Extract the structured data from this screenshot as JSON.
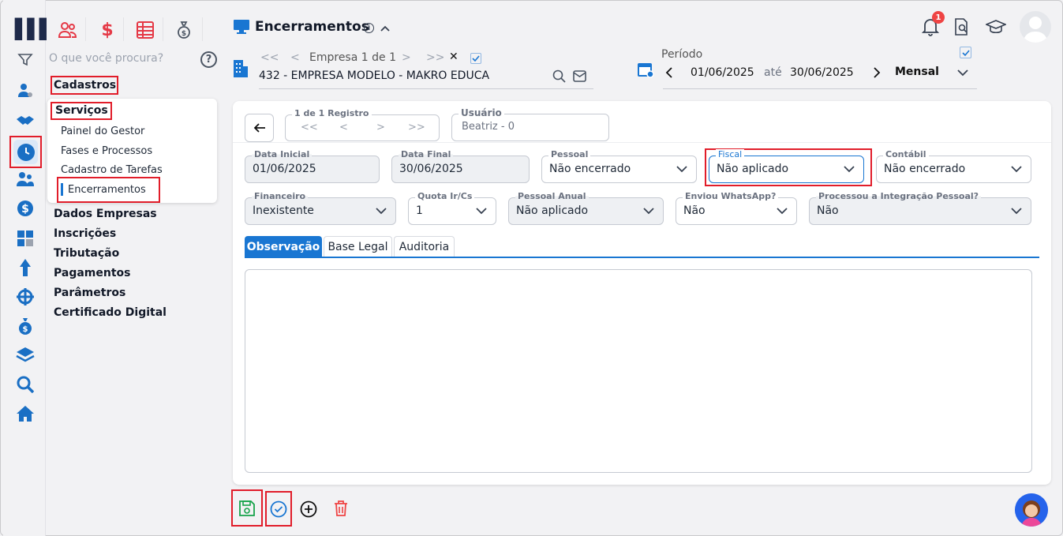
{
  "app": {
    "title": "Encerramentos"
  },
  "search": {
    "placeholder": "O que você procura?"
  },
  "menu": {
    "cadastros": "Cadastros",
    "servicos": "Serviços",
    "servicos_items": [
      "Painel do Gestor",
      "Fases e Processos",
      "Cadastro de Tarefas",
      "Encerramentos"
    ],
    "sections": [
      "Dados Empresas",
      "Inscrições",
      "Tributação",
      "Pagamentos",
      "Parâmetros",
      "Certificado Digital"
    ]
  },
  "header": {
    "nav_first": "<<",
    "nav_prev": "<",
    "empresa_counter": "Empresa 1 de 1",
    "nav_next": ">",
    "nav_last": ">>",
    "close": "✕",
    "empresa_name": "432 - EMPRESA MODELO - MAKRO EDUCA",
    "periodo_label": "Período",
    "date_from": "01/06/2025",
    "ate": "até",
    "date_to": "30/06/2025",
    "period_type": "Mensal",
    "notification_count": "1"
  },
  "record": {
    "label": "1 de 1 Registro",
    "first": "<<",
    "prev": "<",
    "next": ">",
    "last": ">>",
    "usuario_label": "Usuário",
    "usuario_value": "Beatriz - 0"
  },
  "form": {
    "data_inicial": {
      "label": "Data Inicial",
      "value": "01/06/2025"
    },
    "data_final": {
      "label": "Data Final",
      "value": "30/06/2025"
    },
    "pessoal": {
      "label": "Pessoal",
      "value": "Não encerrado"
    },
    "fiscal": {
      "label": "Fiscal",
      "value": "Não aplicado"
    },
    "contabil": {
      "label": "Contábil",
      "value": "Não encerrado"
    },
    "financeiro": {
      "label": "Financeiro",
      "value": "Inexistente"
    },
    "quota": {
      "label": "Quota Ir/Cs",
      "value": "1"
    },
    "pessoal_anual": {
      "label": "Pessoal Anual",
      "value": "Não aplicado"
    },
    "whatsapp": {
      "label": "Enviou WhatsApp?",
      "value": "Não"
    },
    "integracao": {
      "label": "Processou a Integração Pessoal?",
      "value": "Não"
    }
  },
  "tabs": [
    "Observação",
    "Base Legal",
    "Auditoria"
  ],
  "colors": {
    "accent": "#1976d2",
    "highlight": "#e11d2a",
    "rail_icon": "#1a6fc4",
    "quick_icon": "#e53946",
    "save": "#16a34a",
    "delete": "#ef4444"
  },
  "icons": {
    "rail": [
      "filter-icon",
      "user-gear-icon",
      "handshake-icon",
      "clock-icon",
      "users-icon",
      "dollar-icon",
      "calculator-icon",
      "tree-icon",
      "network-icon",
      "money-bag-icon",
      "layers-icon",
      "search-icon",
      "home-icon"
    ],
    "quick": [
      "users-icon",
      "dollar-icon",
      "spreadsheet-icon",
      "money-bag-icon"
    ]
  }
}
